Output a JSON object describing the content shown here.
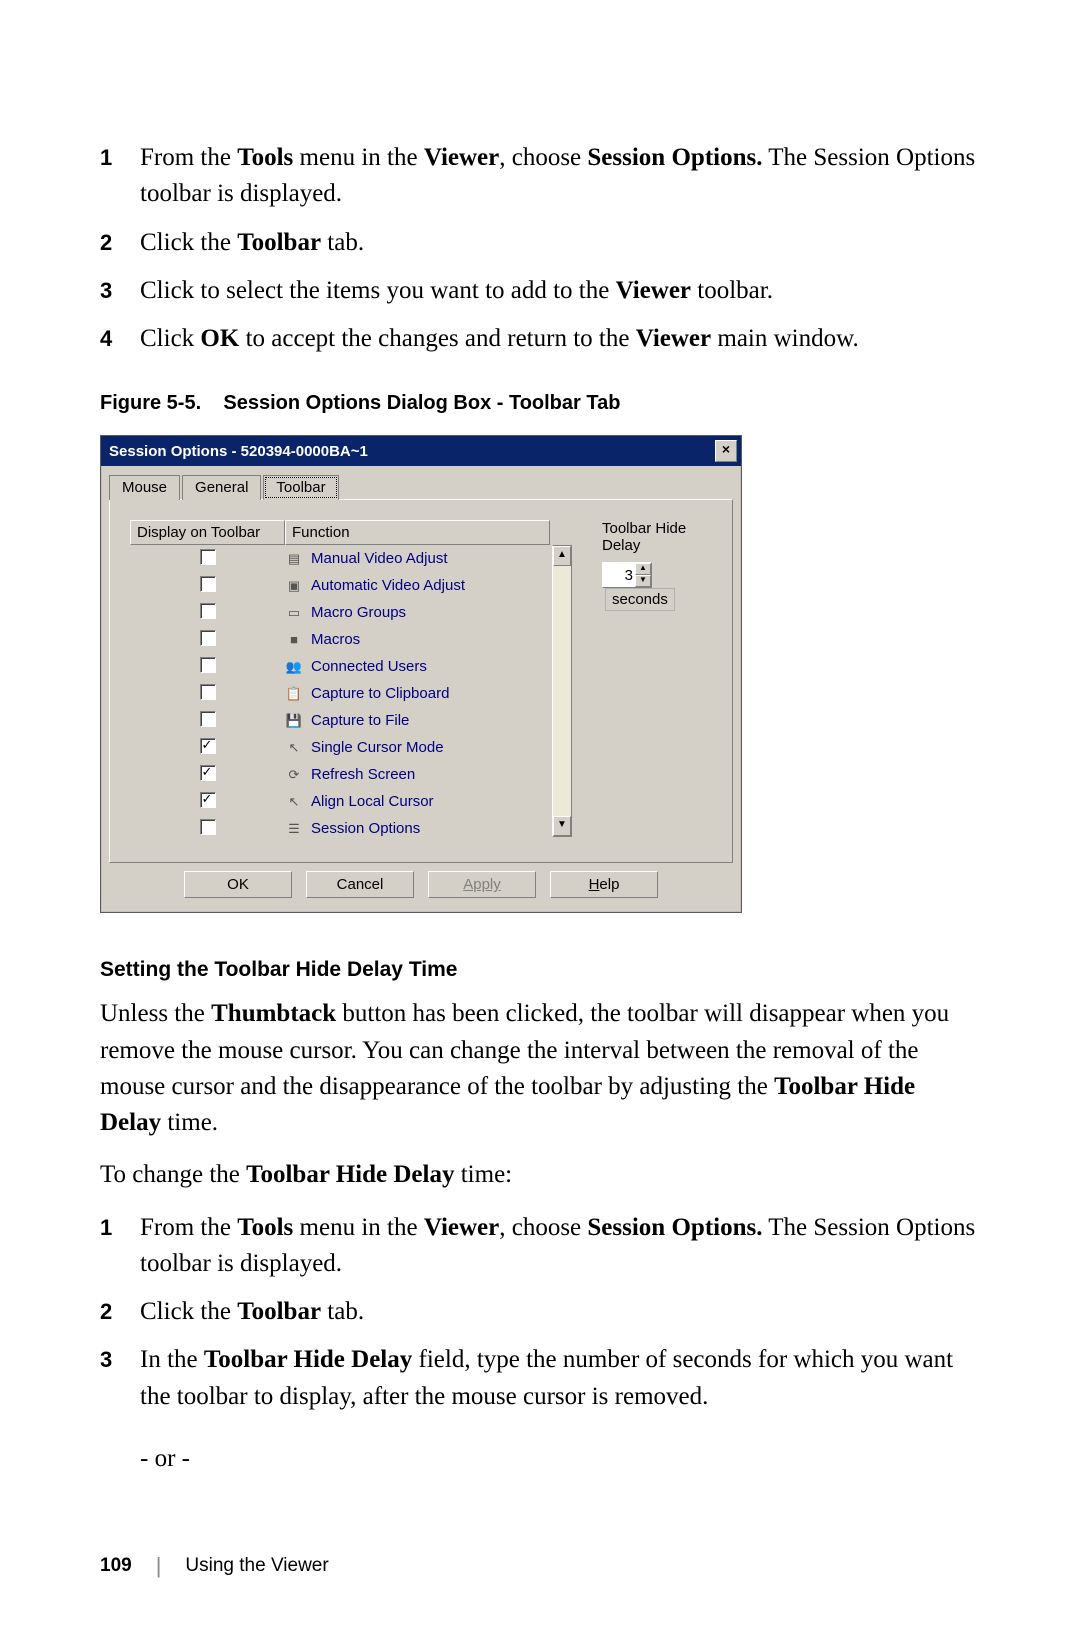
{
  "steps_top": [
    {
      "num": "1",
      "parts": [
        "From the ",
        {
          "b": "Tools"
        },
        " menu in the ",
        {
          "b": "Viewer"
        },
        ", choose ",
        {
          "b": "Session Options."
        },
        " The Session Options toolbar is displayed."
      ]
    },
    {
      "num": "2",
      "parts": [
        "Click the ",
        {
          "b": "Toolbar"
        },
        " tab."
      ]
    },
    {
      "num": "3",
      "parts": [
        "Click to select the items you want to add to the ",
        {
          "b": "Viewer"
        },
        " toolbar."
      ]
    },
    {
      "num": "4",
      "parts": [
        "Click ",
        {
          "b": "OK"
        },
        " to accept the changes and return to the ",
        {
          "b": "Viewer"
        },
        " main window."
      ]
    }
  ],
  "figure_caption": {
    "label": "Figure 5-5.",
    "title": "Session Options Dialog Box - Toolbar Tab"
  },
  "dialog": {
    "title": "Session Options - 520394-0000BA~1",
    "close": "×",
    "tabs": {
      "mouse": "Mouse",
      "general": "General",
      "toolbar": "Toolbar"
    },
    "headers": {
      "display": "Display on Toolbar",
      "function": "Function",
      "delay": "Toolbar Hide Delay"
    },
    "items": [
      {
        "checked": false,
        "icon": "▤",
        "icon_name": "manual-video-adjust-icon",
        "label": "Manual Video Adjust"
      },
      {
        "checked": false,
        "icon": "▣",
        "icon_name": "automatic-video-adjust-icon",
        "label": "Automatic Video Adjust"
      },
      {
        "checked": false,
        "icon": "▭",
        "icon_name": "macro-groups-icon",
        "label": "Macro Groups"
      },
      {
        "checked": false,
        "icon": "■",
        "icon_name": "macros-icon",
        "label": "Macros"
      },
      {
        "checked": false,
        "icon": "👥",
        "icon_name": "connected-users-icon",
        "label": "Connected Users"
      },
      {
        "checked": false,
        "icon": "📋",
        "icon_name": "capture-clipboard-icon",
        "label": "Capture to Clipboard"
      },
      {
        "checked": false,
        "icon": "💾",
        "icon_name": "capture-file-icon",
        "label": "Capture to File"
      },
      {
        "checked": true,
        "icon": "↖",
        "icon_name": "single-cursor-mode-icon",
        "label": "Single Cursor Mode"
      },
      {
        "checked": true,
        "icon": "⟳",
        "icon_name": "refresh-screen-icon",
        "label": "Refresh Screen"
      },
      {
        "checked": true,
        "icon": "↖",
        "icon_name": "align-local-cursor-icon",
        "label": "Align Local Cursor"
      },
      {
        "checked": false,
        "icon": "☰",
        "icon_name": "session-options-icon",
        "label": "Session Options"
      }
    ],
    "delay": {
      "value": "3",
      "seconds_label": "seconds"
    },
    "buttons": {
      "ok": "OK",
      "cancel": "Cancel",
      "apply": "Apply",
      "help_prefix": "H",
      "help_rest": "elp"
    }
  },
  "section_heading": "Setting the Toolbar Hide Delay Time",
  "para1_parts": [
    "Unless the ",
    {
      "b": "Thumbtack"
    },
    " button has been clicked, the toolbar will disappear when you remove the mouse cursor. You can change the interval between the removal of the mouse cursor and the disappearance of the toolbar by adjusting the ",
    {
      "b": "Toolbar Hide Delay"
    },
    " time."
  ],
  "para2_parts": [
    "To change the ",
    {
      "b": "Toolbar Hide Delay"
    },
    " time:"
  ],
  "steps_bottom": [
    {
      "num": "1",
      "parts": [
        "From the ",
        {
          "b": "Tools"
        },
        " menu in the ",
        {
          "b": "Viewer"
        },
        ", choose ",
        {
          "b": "Session Options."
        },
        " The Session Options toolbar is displayed."
      ]
    },
    {
      "num": "2",
      "parts": [
        "Click the ",
        {
          "b": "Toolbar"
        },
        " tab."
      ]
    },
    {
      "num": "3",
      "parts": [
        "In the ",
        {
          "b": "Toolbar Hide Delay"
        },
        " field, type the number of seconds for which you want the toolbar to display, after the mouse cursor is removed."
      ]
    }
  ],
  "or_text": "- or -",
  "footer": {
    "page": "109",
    "section": "Using the Viewer"
  }
}
